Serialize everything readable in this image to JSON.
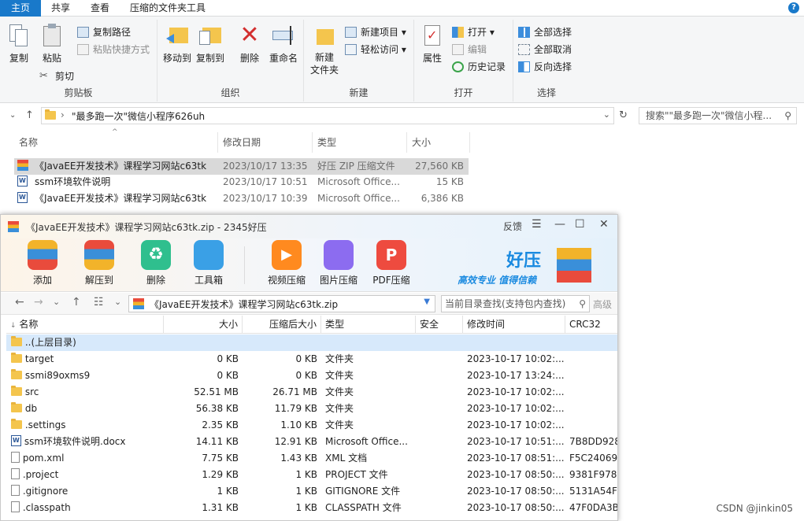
{
  "explorer": {
    "tabs": [
      "主页",
      "共享",
      "查看",
      "压缩的文件夹工具"
    ],
    "help": "?",
    "groups": {
      "clipboard": "剪贴板",
      "organize": "组织",
      "new": "新建",
      "open": "打开",
      "select": "选择"
    },
    "buttons": {
      "copy": "复制",
      "paste": "粘贴",
      "copy_path": "复制路径",
      "paste_shortcut": "粘贴快捷方式",
      "cut": "剪切",
      "move_to": "移动到",
      "copy_to": "复制到",
      "delete": "删除",
      "rename": "重命名",
      "new_folder": "新建\n文件夹",
      "new_item": "新建项目 ▾",
      "easy_access": "轻松访问 ▾",
      "properties": "属性",
      "open": "打开 ▾",
      "edit": "编辑",
      "history": "历史记录",
      "select_all": "全部选择",
      "select_none": "全部取消",
      "invert": "反向选择"
    },
    "address": "\"最多跑一次\"微信小程序626uh",
    "search_placeholder": "搜索\"\"最多跑一次\"微信小程...",
    "columns": [
      "名称",
      "修改日期",
      "类型",
      "大小"
    ],
    "files": [
      {
        "name": "《JavaEE开发技术》课程学习网站c63tk",
        "date": "2023/10/17 13:35",
        "type": "好压 ZIP 压缩文件",
        "size": "27,560 KB"
      },
      {
        "name": "ssm环境软件说明",
        "date": "2023/10/17 10:51",
        "type": "Microsoft Office...",
        "size": "15 KB"
      },
      {
        "name": "《JavaEE开发技术》课程学习网站c63tk",
        "date": "2023/10/17 10:39",
        "type": "Microsoft Office...",
        "size": "6,386 KB"
      }
    ]
  },
  "haozip": {
    "title": "《JavaEE开发技术》课程学习网站c63tk.zip - 2345好压",
    "title_feedback": "反馈",
    "toolbar": [
      "添加",
      "解压到",
      "删除",
      "工具箱",
      "视频压缩",
      "图片压缩",
      "PDF压缩"
    ],
    "brand": "好压",
    "slogan": "高效专业  值得信赖",
    "path": "《JavaEE开发技术》课程学习网站c63tk.zip",
    "find_placeholder": "当前目录查找(支持包内查找)",
    "advanced": "高级",
    "columns": [
      "名称",
      "大小",
      "压缩后大小",
      "类型",
      "安全",
      "修改时间",
      "CRC32"
    ],
    "rows": [
      {
        "name": "..(上层目录)",
        "icon": "folder",
        "size": "",
        "packed": "",
        "type": "",
        "time": "",
        "crc": ""
      },
      {
        "name": "target",
        "icon": "folder",
        "size": "0 KB",
        "packed": "0 KB",
        "type": "文件夹",
        "time": "2023-10-17 10:02:...",
        "crc": ""
      },
      {
        "name": "ssmi89oxms9",
        "icon": "folder",
        "size": "0 KB",
        "packed": "0 KB",
        "type": "文件夹",
        "time": "2023-10-17 13:24:...",
        "crc": ""
      },
      {
        "name": "src",
        "icon": "folder",
        "size": "52.51 MB",
        "packed": "26.71 MB",
        "type": "文件夹",
        "time": "2023-10-17 10:02:...",
        "crc": ""
      },
      {
        "name": "db",
        "icon": "folder",
        "size": "56.38 KB",
        "packed": "11.79 KB",
        "type": "文件夹",
        "time": "2023-10-17 10:02:...",
        "crc": ""
      },
      {
        "name": ".settings",
        "icon": "folder",
        "size": "2.35 KB",
        "packed": "1.10 KB",
        "type": "文件夹",
        "time": "2023-10-17 10:02:...",
        "crc": ""
      },
      {
        "name": "ssm环境软件说明.docx",
        "icon": "word",
        "size": "14.11 KB",
        "packed": "12.91 KB",
        "type": "Microsoft Office...",
        "time": "2023-10-17 10:51:...",
        "crc": "7B8DD928"
      },
      {
        "name": "pom.xml",
        "icon": "doc",
        "size": "7.75 KB",
        "packed": "1.43 KB",
        "type": "XML 文档",
        "time": "2023-10-17 08:51:...",
        "crc": "F5C24069"
      },
      {
        "name": ".project",
        "icon": "doc",
        "size": "1.29 KB",
        "packed": "1 KB",
        "type": "PROJECT 文件",
        "time": "2023-10-17 08:50:...",
        "crc": "9381F978"
      },
      {
        "name": ".gitignore",
        "icon": "doc",
        "size": "1 KB",
        "packed": "1 KB",
        "type": "GITIGNORE 文件",
        "time": "2023-10-17 08:50:...",
        "crc": "5131A54F"
      },
      {
        "name": ".classpath",
        "icon": "doc",
        "size": "1.31 KB",
        "packed": "1 KB",
        "type": "CLASSPATH 文件",
        "time": "2023-10-17 08:50:...",
        "crc": "47F0DA3B"
      }
    ]
  },
  "watermark": "CSDN @jinkin05"
}
